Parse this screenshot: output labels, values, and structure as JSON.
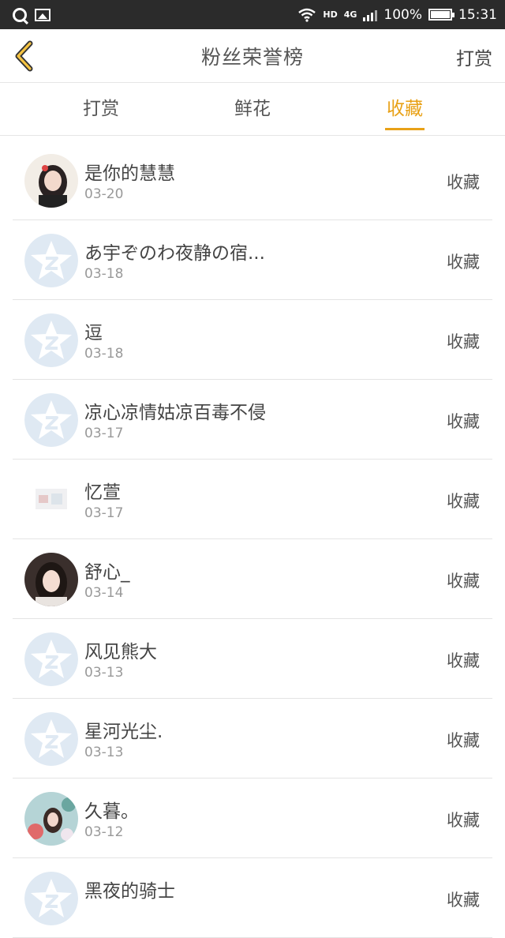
{
  "status_bar": {
    "lte_label": "HD",
    "network": "4G",
    "battery": "100%",
    "time": "15:31"
  },
  "header": {
    "title": "粉丝荣誉榜",
    "right_label": "打赏"
  },
  "tabs": [
    {
      "label": "打赏",
      "active": false
    },
    {
      "label": "鲜花",
      "active": false
    },
    {
      "label": "收藏",
      "active": true
    }
  ],
  "accent_color": "#e8a117",
  "list": [
    {
      "name": "是你的慧慧",
      "date": "03-20",
      "action": "收藏",
      "avatar": "photo-girl-icon"
    },
    {
      "name": "あ宇ぞのわ夜静の宿...",
      "date": "03-18",
      "action": "收藏",
      "avatar": "default-star-avatar-icon"
    },
    {
      "name": "逗",
      "date": "03-18",
      "action": "收藏",
      "avatar": "default-star-avatar-icon"
    },
    {
      "name": "凉心凉情姑凉百毒不侵",
      "date": "03-17",
      "action": "收藏",
      "avatar": "default-star-avatar-icon"
    },
    {
      "name": "忆萱",
      "date": "03-17",
      "action": "收藏",
      "avatar": "photo-room-icon"
    },
    {
      "name": "舒心_",
      "date": "03-14",
      "action": "收藏",
      "avatar": "photo-portrait-icon"
    },
    {
      "name": "风见熊大",
      "date": "03-13",
      "action": "收藏",
      "avatar": "default-star-avatar-icon"
    },
    {
      "name": "星河光尘.",
      "date": "03-13",
      "action": "收藏",
      "avatar": "default-star-avatar-icon"
    },
    {
      "name": "久暮。",
      "date": "03-12",
      "action": "收藏",
      "avatar": "photo-flowers-icon"
    },
    {
      "name": "黑夜的骑士",
      "date": "",
      "action": "收藏",
      "avatar": "default-star-avatar-icon"
    }
  ]
}
